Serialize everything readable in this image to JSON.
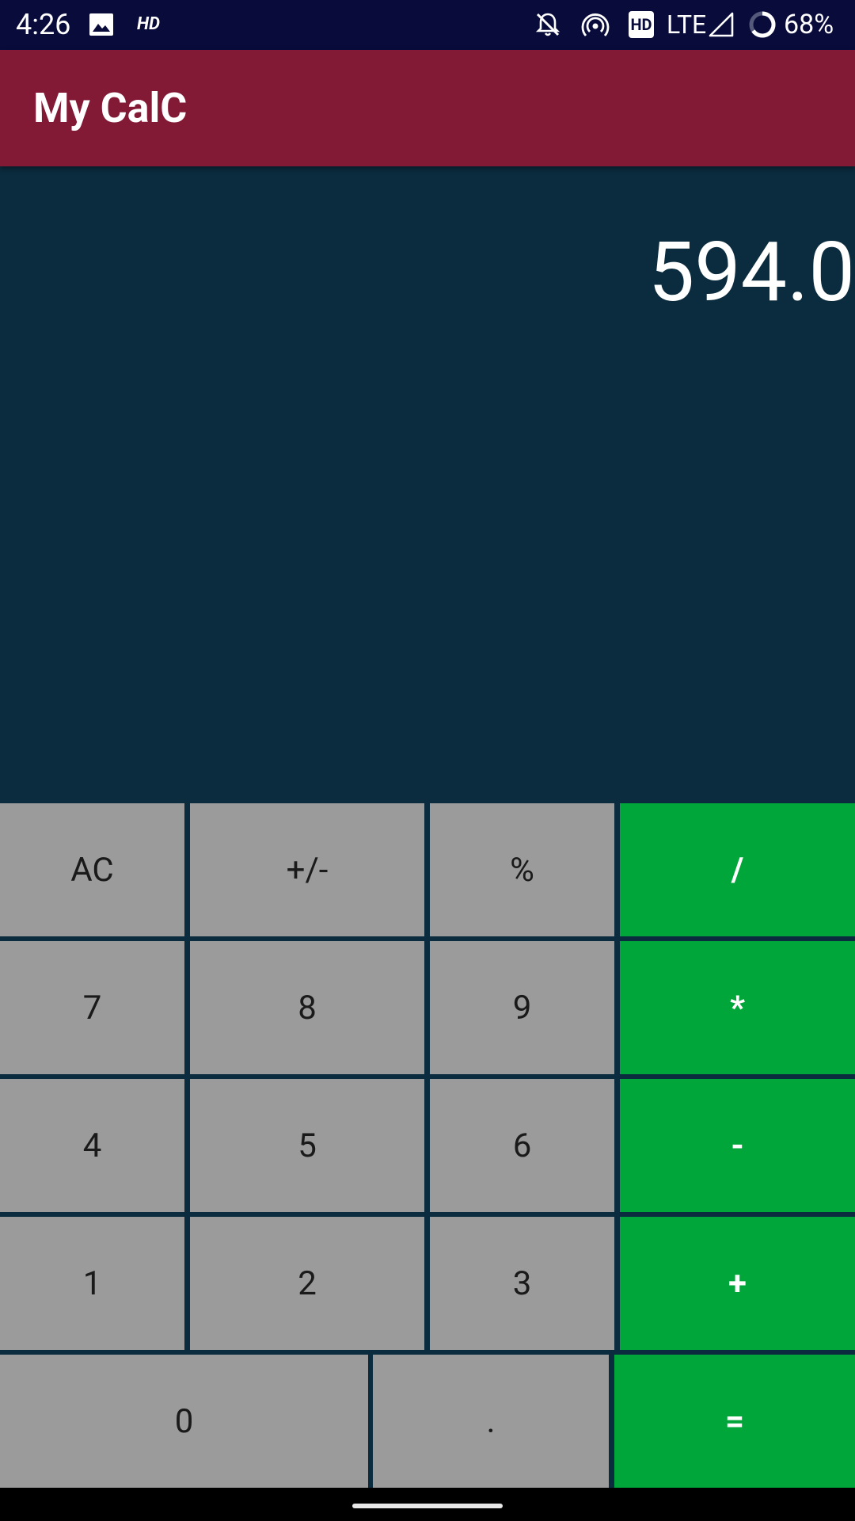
{
  "status_bar": {
    "time": "4:26",
    "hd_label": "HD",
    "hd_badge": "HD",
    "network": "LTE",
    "battery": "68%",
    "icons": [
      "image-icon",
      "hd-icon",
      "bell-off-icon",
      "hotspot-icon",
      "hd-voice-icon",
      "signal-icon",
      "battery-ring-icon"
    ]
  },
  "app_bar": {
    "title": "My CalC"
  },
  "display": {
    "value": "594.0"
  },
  "keypad": {
    "rows": [
      [
        "AC",
        "+/-",
        "%",
        "/"
      ],
      [
        "7",
        "8",
        "9",
        "*"
      ],
      [
        "4",
        "5",
        "6",
        "-"
      ],
      [
        "1",
        "2",
        "3",
        "+"
      ],
      [
        "0",
        ".",
        "="
      ]
    ]
  },
  "colors": {
    "status_bar": "#090b3b",
    "app_bar": "#821935",
    "background": "#0b2b3e",
    "key_gray": "#9b9b9b",
    "key_green": "#00a63a"
  }
}
